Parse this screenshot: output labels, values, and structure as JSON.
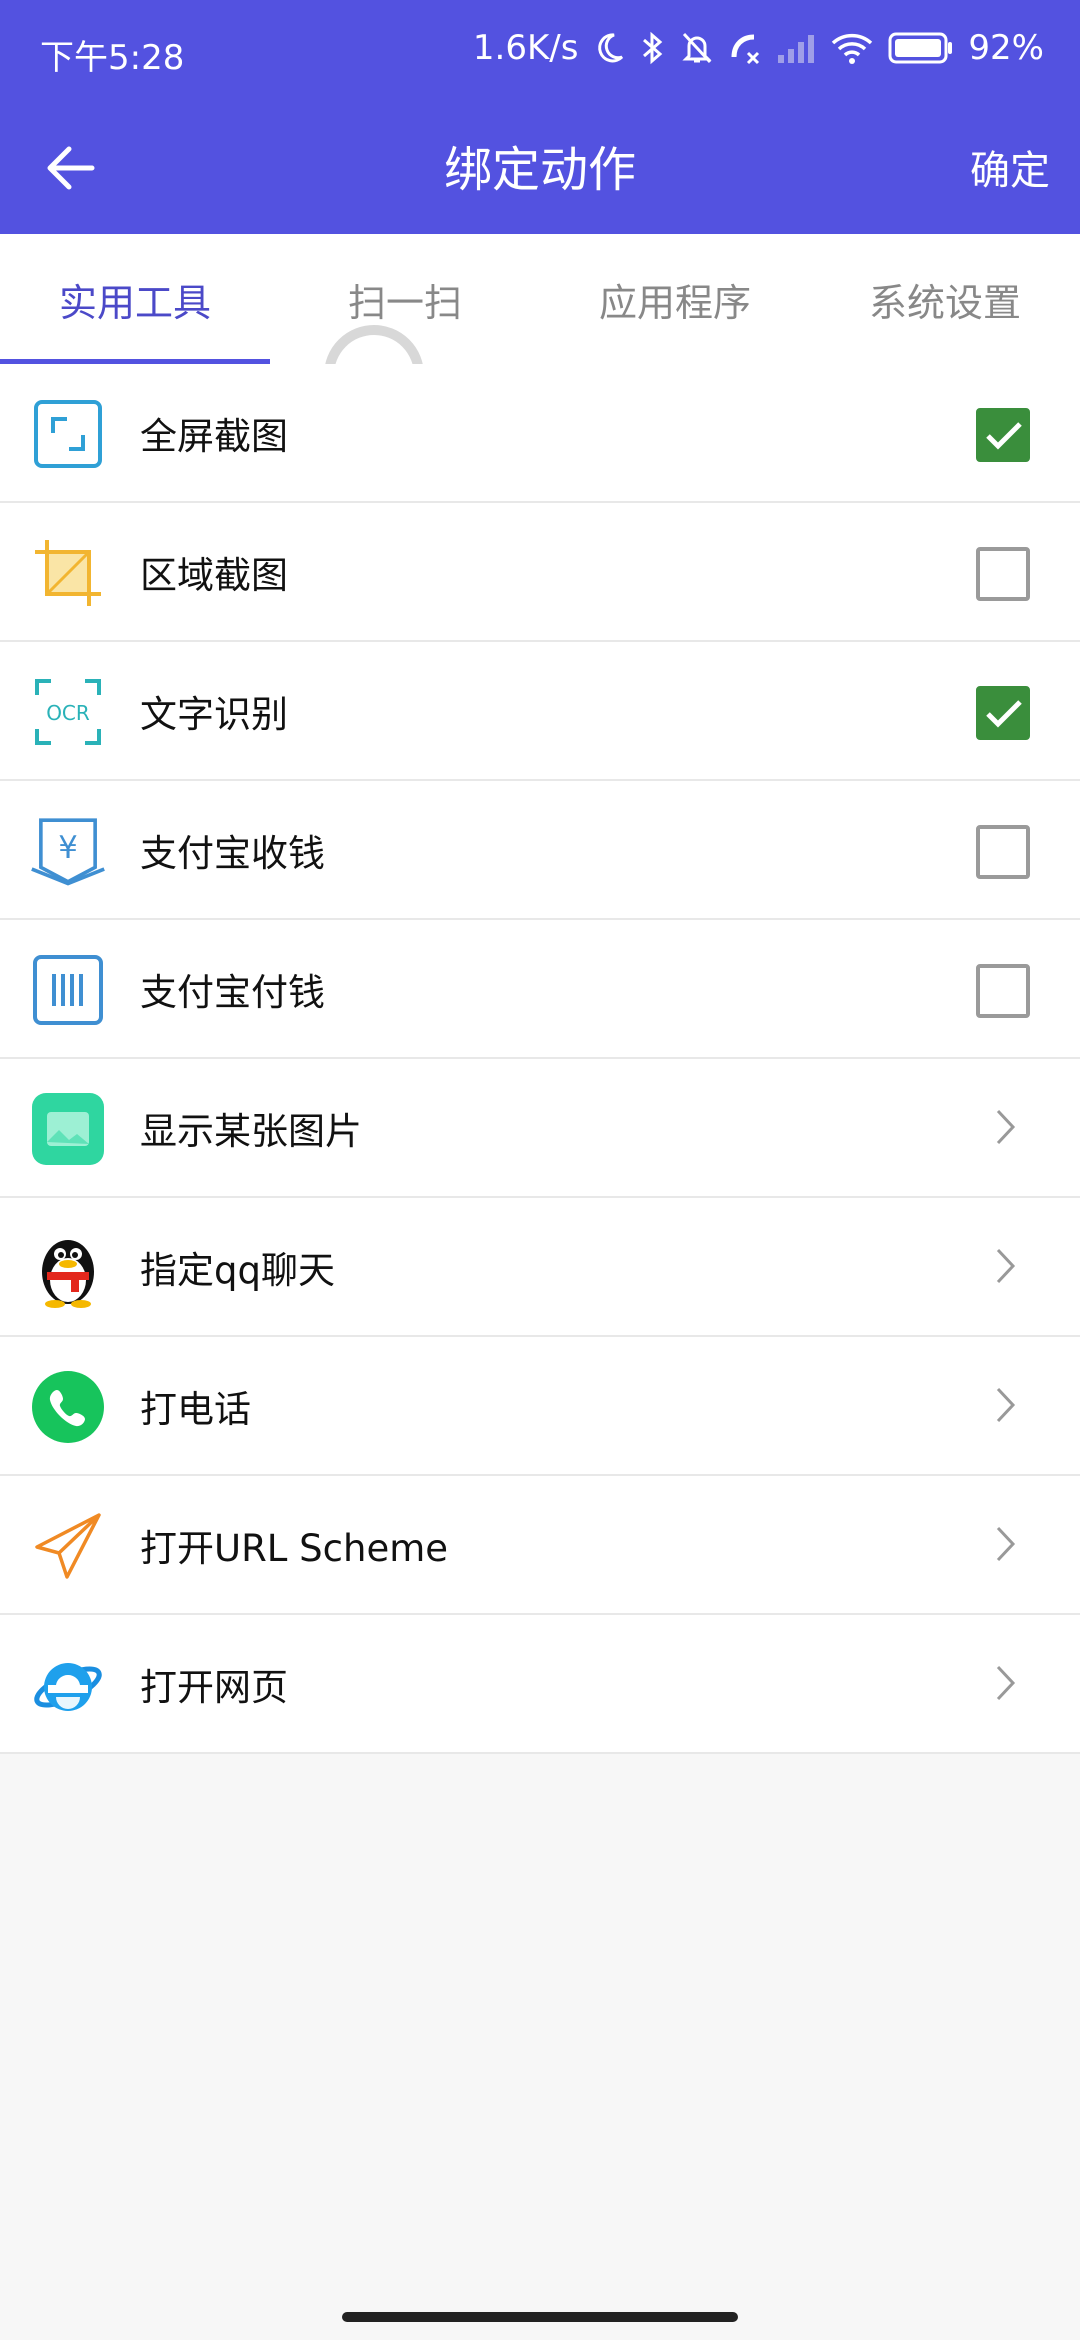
{
  "status_bar": {
    "time": "下午5:28",
    "network_speed": "1.6K/s",
    "battery": "92%"
  },
  "header": {
    "title": "绑定动作",
    "confirm_label": "确定"
  },
  "tabs": [
    {
      "label": "实用工具",
      "active": true
    },
    {
      "label": "扫一扫",
      "active": false
    },
    {
      "label": "应用程序",
      "active": false
    },
    {
      "label": "系统设置",
      "active": false
    }
  ],
  "items": [
    {
      "label": "全屏截图",
      "icon": "fullscreen-screenshot-icon",
      "control": "checkbox",
      "checked": true
    },
    {
      "label": "区域截图",
      "icon": "crop-icon",
      "control": "checkbox",
      "checked": false
    },
    {
      "label": "文字识别",
      "icon": "ocr-icon",
      "control": "checkbox",
      "checked": true
    },
    {
      "label": "支付宝收钱",
      "icon": "alipay-receive-icon",
      "control": "checkbox",
      "checked": false
    },
    {
      "label": "支付宝付钱",
      "icon": "alipay-pay-icon",
      "control": "checkbox",
      "checked": false
    },
    {
      "label": "显示某张图片",
      "icon": "image-icon",
      "control": "chevron"
    },
    {
      "label": "指定qq聊天",
      "icon": "qq-penguin-icon",
      "control": "chevron"
    },
    {
      "label": "打电话",
      "icon": "phone-icon",
      "control": "chevron"
    },
    {
      "label": "打开URL Scheme",
      "icon": "paper-plane-icon",
      "control": "chevron"
    },
    {
      "label": "打开网页",
      "icon": "ie-browser-icon",
      "control": "chevron"
    }
  ],
  "colors": {
    "primary": "#5352e0",
    "tab_active": "#4b49c8",
    "check_green": "#3a8e3c"
  }
}
